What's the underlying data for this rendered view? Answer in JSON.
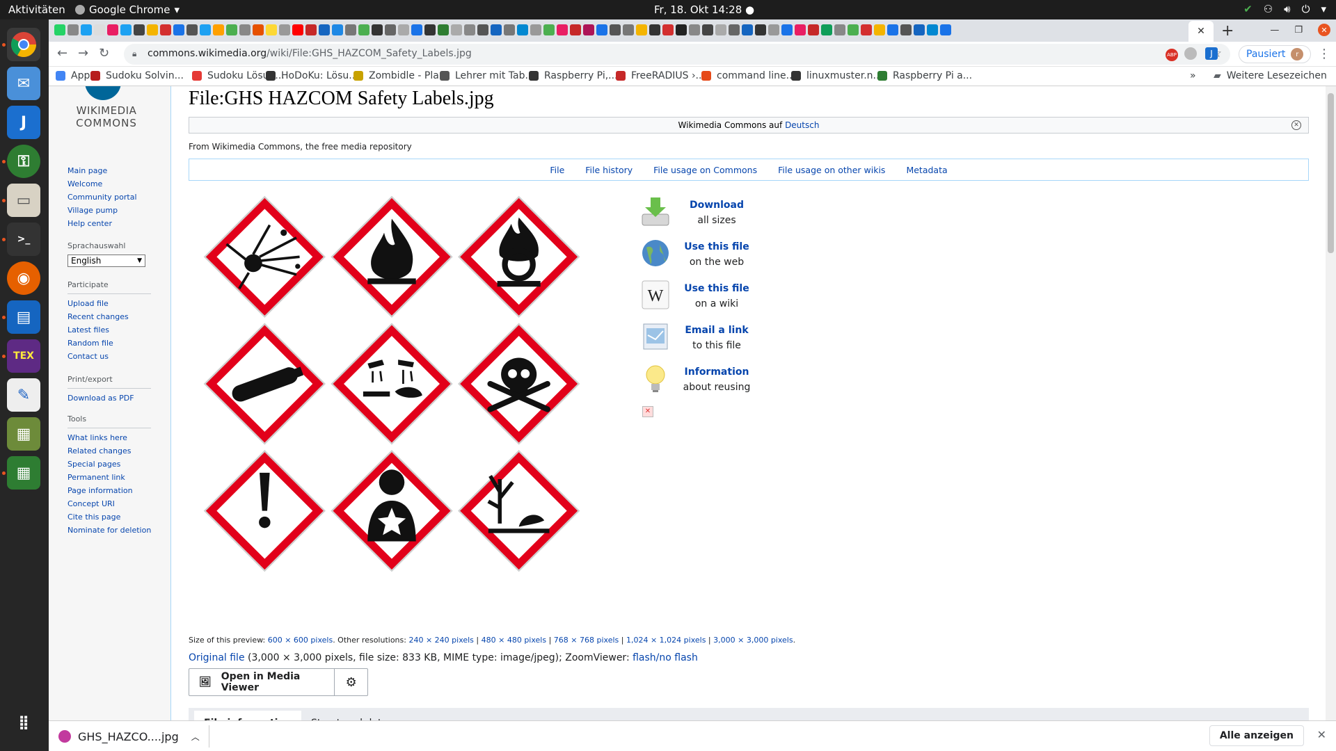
{
  "system": {
    "activities": "Aktivitäten",
    "app_name": "Google Chrome",
    "clock": "Fr, 18. Okt  14:28"
  },
  "browser": {
    "url_host": "commons.wikimedia.org",
    "url_path": "/wiki/File:GHS_HAZCOM_Safety_Labels.jpg",
    "profile_label": "Pausiert",
    "profile_initial": "r",
    "extension_label": "ABP",
    "bookmarks": [
      {
        "label": "Apps",
        "color": "#4285f4"
      },
      {
        "label": "Sudoku Solvin...",
        "color": "#b71c1c"
      },
      {
        "label": "Sudoku Lösun...",
        "color": "#e53935"
      },
      {
        "label": "HoDoKu: Lösu...",
        "color": "#333333"
      },
      {
        "label": "Zombidle - Pla...",
        "color": "#c8a200"
      },
      {
        "label": "Lehrer mit Tab...",
        "color": "#555555"
      },
      {
        "label": "Raspberry Pi,...",
        "color": "#333333"
      },
      {
        "label": "FreeRADIUS ›...",
        "color": "#c62828"
      },
      {
        "label": "command line...",
        "color": "#e64a19"
      },
      {
        "label": "linuxmuster.n...",
        "color": "#333333"
      },
      {
        "label": "Raspberry Pi a...",
        "color": "#2e7d32"
      }
    ],
    "bookmarks_more": "»",
    "other_bookmarks": "Weitere Lesezeichen"
  },
  "sidebar": {
    "logo_line1": "WIKIMEDIA",
    "logo_line2": "COMMONS",
    "nav": [
      "Main page",
      "Welcome",
      "Community portal",
      "Village pump",
      "Help center"
    ],
    "lang_heading": "Sprachauswahl",
    "lang_value": "English",
    "participate_heading": "Participate",
    "participate": [
      "Upload file",
      "Recent changes",
      "Latest files",
      "Random file",
      "Contact us"
    ],
    "print_heading": "Print/export",
    "print": [
      "Download as PDF"
    ],
    "tools_heading": "Tools",
    "tools": [
      "What links here",
      "Related changes",
      "Special pages",
      "Permanent link",
      "Page information",
      "Concept URI",
      "Cite this page",
      "Nominate for deletion"
    ]
  },
  "content": {
    "title": "File:GHS HAZCOM Safety Labels.jpg",
    "notice_text": "Wikimedia Commons auf ",
    "notice_link": "Deutsch",
    "site_sub": "From Wikimedia Commons, the free media repository",
    "file_toc": [
      "File",
      "File history",
      "File usage on Commons",
      "File usage on other wikis",
      "Metadata"
    ],
    "side_links": [
      {
        "bold": "Download",
        "rest": "all sizes",
        "icon": "download-icon"
      },
      {
        "bold": "Use this file",
        "rest": "on the web",
        "icon": "globe-icon"
      },
      {
        "bold": "Use this file",
        "rest": "on a wiki",
        "icon": "wikipedia-icon"
      },
      {
        "bold": "Email a link",
        "rest": "to this file",
        "icon": "email-icon"
      },
      {
        "bold": "Information",
        "rest": "about reusing",
        "icon": "lightbulb-icon"
      }
    ],
    "preview_label": "Size of this preview: ",
    "preview_size": "600 × 600 pixels",
    "other_res_label": ". Other resolutions: ",
    "other_res": [
      "240 × 240 pixels",
      "480 × 480 pixels",
      "768 × 768 pixels",
      "1,024 × 1,024 pixels",
      "3,000 × 3,000 pixels"
    ],
    "original_link": "Original file",
    "original_info": " (3,000 × 3,000 pixels, file size: 833 KB, MIME type: image/jpeg); ZoomViewer: ",
    "zoom_link": "flash/no flash",
    "media_viewer_btn": "Open in Media Viewer",
    "bottom_tabs": [
      "File information",
      "Structured data"
    ]
  },
  "downloads": {
    "filename": "GHS_HAZCO....jpg",
    "show_all": "Alle anzeigen"
  },
  "colors": {
    "link": "#0645ad",
    "hazard_red": "#e2001a"
  }
}
